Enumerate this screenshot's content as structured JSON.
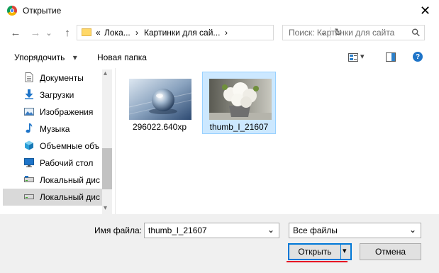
{
  "window": {
    "title": "Открытие",
    "close_glyph": "✕"
  },
  "nav": {
    "back_glyph": "←",
    "forward_glyph": "→",
    "dropdown_glyph": "⌄",
    "up_glyph": "↑"
  },
  "address": {
    "breadcrumbs": [
      "«",
      "Лока...",
      "›",
      "Картинки для сай...",
      "›"
    ],
    "dropdown_glyph": "⌄",
    "refresh_glyph": "↻"
  },
  "search": {
    "placeholder": "Поиск: Картинки для сайта",
    "icon_glyph": "⚲"
  },
  "toolbar": {
    "organize_label": "Упорядочить",
    "organize_arrow": "▾",
    "new_folder_label": "Новая папка",
    "view_arrow": "▾",
    "help_glyph": "?"
  },
  "sidebar": {
    "items": [
      {
        "label": "Документы",
        "icon": "documents-icon",
        "selected": false
      },
      {
        "label": "Загрузки",
        "icon": "downloads-icon",
        "selected": false
      },
      {
        "label": "Изображения",
        "icon": "pictures-icon",
        "selected": false
      },
      {
        "label": "Музыка",
        "icon": "music-icon",
        "selected": false
      },
      {
        "label": "Объемные объ",
        "icon": "3d-objects-icon",
        "selected": false
      },
      {
        "label": "Рабочий стол",
        "icon": "desktop-icon",
        "selected": false
      },
      {
        "label": "Локальный дис",
        "icon": "drive-icon",
        "selected": false
      },
      {
        "label": "Локальный дис",
        "icon": "drive-icon",
        "selected": true
      }
    ],
    "scroll_up_glyph": "▴",
    "scroll_down_glyph": "▾"
  },
  "files": [
    {
      "name": "296022.640xp",
      "thumb": "glass-sphere-image",
      "selected": false
    },
    {
      "name": "thumb_l_21607",
      "thumb": "white-flowers-image",
      "selected": true
    }
  ],
  "bottom": {
    "filename_label": "Имя файла:",
    "filename_value": "thumb_l_21607",
    "filename_dropdown_glyph": "⌄",
    "filetype_value": "Все файлы",
    "filetype_dropdown_glyph": "⌄",
    "open_label": "Открыть",
    "open_split_glyph": "▾",
    "cancel_label": "Отмена"
  },
  "colors": {
    "accent": "#0078d7",
    "selection": "#cce8ff",
    "annotation_underline": "#e81123"
  }
}
